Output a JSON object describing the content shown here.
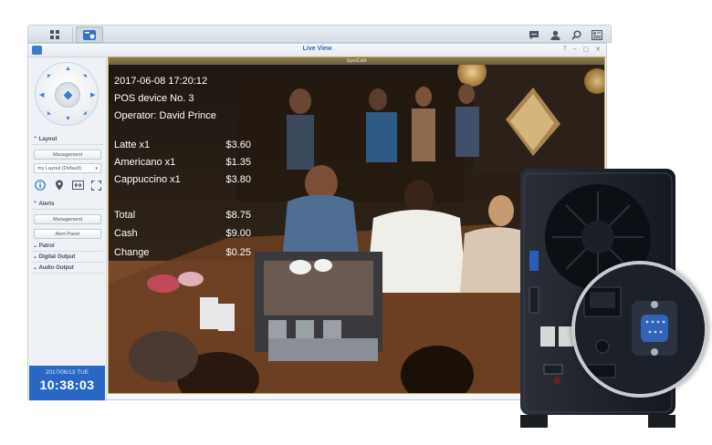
{
  "taskbar": {
    "icons": [
      "apps-grid-icon",
      "surveillance-app-icon",
      "chat-icon",
      "user-icon",
      "search-icon",
      "widgets-icon"
    ]
  },
  "window": {
    "title": "Live View",
    "controls": [
      "?",
      "–",
      "▢",
      "✕"
    ]
  },
  "sidebar": {
    "layout_section": "Layout",
    "layout_management": "Management",
    "layout_select": "my Layout (Default)",
    "alerts_section": "Alerts",
    "alerts_management": "Management",
    "alert_panel": "Alert Panel",
    "patrol": "Patrol",
    "digital_output": "Digital Output",
    "audio_output": "Audio Output",
    "date": "2017/06/13 TUE",
    "time": "10:38:03"
  },
  "video": {
    "title": "SynoCafé",
    "overlay": {
      "datetime": "2017-06-08 17:20:12",
      "device": "POS device No. 3",
      "operator": "Operator:  David Prince",
      "items": [
        {
          "name": "Latte x1",
          "price": "$3.60"
        },
        {
          "name": "Americano x1",
          "price": "$1.35"
        },
        {
          "name": "Cappuccino x1",
          "price": "$3.80"
        }
      ],
      "total_label": "Total",
      "total_value": "$8.75",
      "cash_label": "Cash",
      "cash_value": "$9.00",
      "change_label": "Change",
      "change_value": "$0.25"
    }
  },
  "colors": {
    "accent": "#2a67c4",
    "link_blue": "#2d68b3",
    "video_border": "#c9a94a"
  }
}
